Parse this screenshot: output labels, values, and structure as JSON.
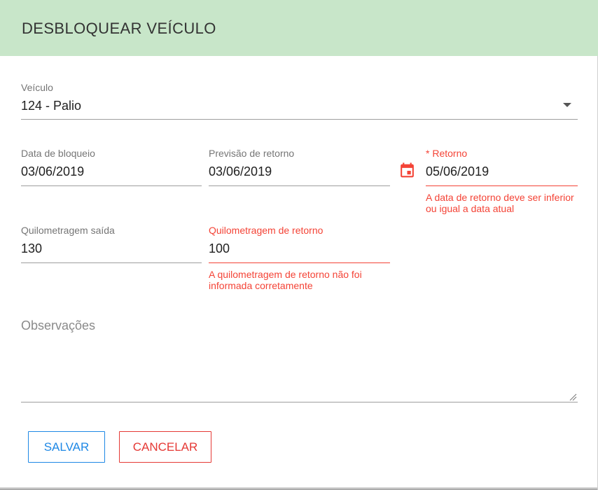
{
  "header": {
    "title": "DESBLOQUEAR VEÍCULO"
  },
  "vehicle": {
    "label": "Veículo",
    "value": "124 - Palio",
    "icon": "dropdown-arrow-icon"
  },
  "block_date": {
    "label": "Data de bloqueio",
    "value": "03/06/2019"
  },
  "expected_return": {
    "label": "Previsão de retorno",
    "value": "03/06/2019"
  },
  "return_date": {
    "label": "* Retorno",
    "value": "05/06/2019",
    "error": "A data de retorno deve ser inferior ou igual a data atual",
    "icon": "calendar-icon"
  },
  "km_out": {
    "label": "Quilometragem saída",
    "value": "130"
  },
  "km_return": {
    "label": "Quilometragem de retorno",
    "value": "100",
    "error": "A quilometragem de retorno não foi informada corretamente"
  },
  "notes": {
    "placeholder": "Observações",
    "value": ""
  },
  "buttons": {
    "save": "SALVAR",
    "cancel": "CANCELAR"
  },
  "colors": {
    "header_bg": "#c8e6c9",
    "error": "#f44336",
    "primary": "#1e88e5",
    "danger": "#e53935"
  }
}
